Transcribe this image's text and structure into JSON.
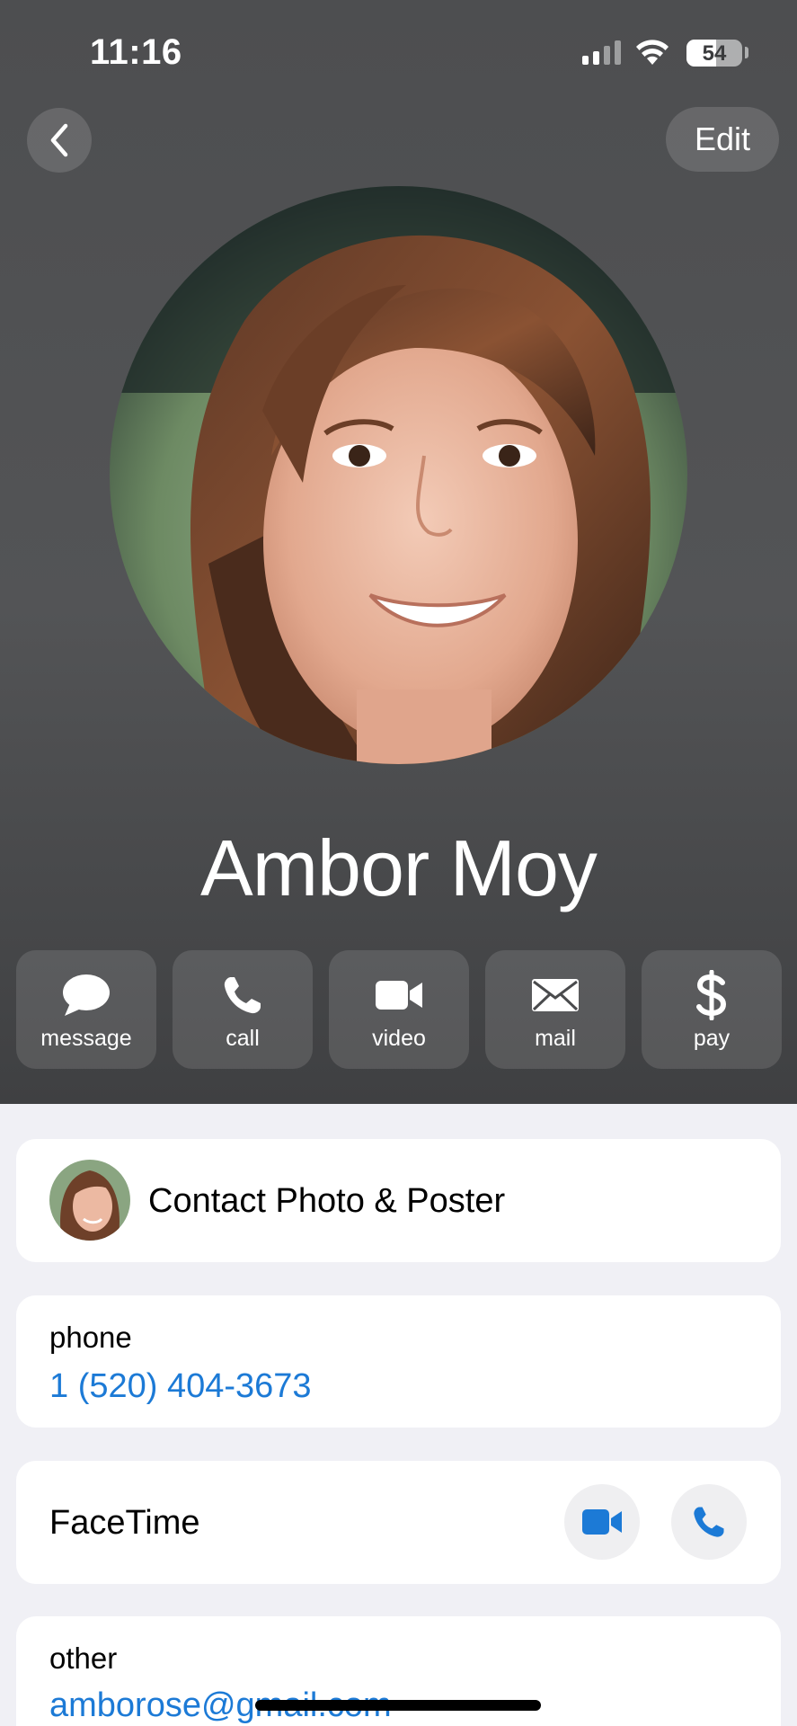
{
  "status_bar": {
    "time": "11:16",
    "battery_level": "54"
  },
  "nav": {
    "edit_label": "Edit"
  },
  "contact": {
    "name": "Ambor Moy"
  },
  "actions": [
    {
      "label": "message",
      "icon": "message-bubble-icon"
    },
    {
      "label": "call",
      "icon": "phone-icon"
    },
    {
      "label": "video",
      "icon": "video-camera-icon"
    },
    {
      "label": "mail",
      "icon": "envelope-icon"
    },
    {
      "label": "pay",
      "icon": "dollar-icon"
    }
  ],
  "poster": {
    "label": "Contact Photo & Poster"
  },
  "phone": {
    "label": "phone",
    "value": "1 (520) 404-3673"
  },
  "facetime": {
    "label": "FaceTime"
  },
  "other": {
    "label": "other",
    "value": "amborose@gmail.com"
  },
  "colors": {
    "accent": "#1c7ad6",
    "hero_bg": "#4f5052",
    "list_bg": "#f0f0f5"
  }
}
